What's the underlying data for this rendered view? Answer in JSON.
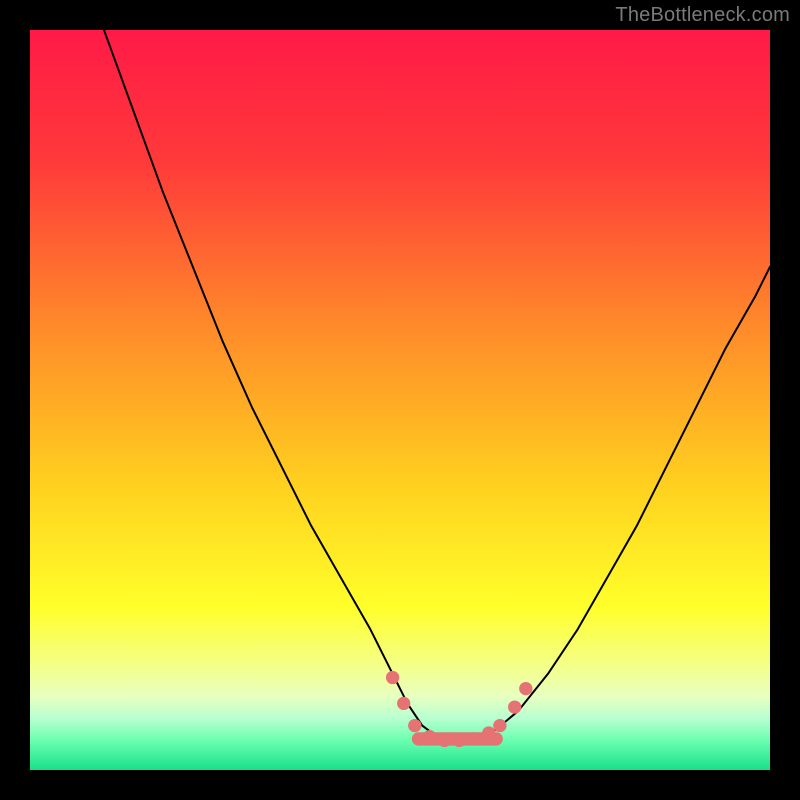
{
  "attribution": "TheBottleneck.com",
  "gradient": {
    "stops": [
      {
        "pct": 0,
        "color": "#ff1a47"
      },
      {
        "pct": 18,
        "color": "#ff3a3a"
      },
      {
        "pct": 40,
        "color": "#ff8a2a"
      },
      {
        "pct": 62,
        "color": "#ffd21f"
      },
      {
        "pct": 78,
        "color": "#ffff2a"
      },
      {
        "pct": 86,
        "color": "#f4ff8a"
      },
      {
        "pct": 90,
        "color": "#e8ffc0"
      },
      {
        "pct": 93,
        "color": "#b8ffd0"
      },
      {
        "pct": 96,
        "color": "#6affb0"
      },
      {
        "pct": 100,
        "color": "#18e08a"
      }
    ]
  },
  "chart_data": {
    "type": "line",
    "title": "",
    "xlabel": "",
    "ylabel": "",
    "xlim": [
      0,
      100
    ],
    "ylim": [
      0,
      100
    ],
    "series": [
      {
        "name": "curve",
        "color": "#000000",
        "stroke_width": 2,
        "x": [
          10,
          14,
          18,
          22,
          26,
          30,
          34,
          38,
          42,
          46,
          49,
          51,
          53,
          55,
          57,
          59,
          61,
          63,
          66,
          70,
          74,
          78,
          82,
          86,
          90,
          94,
          98,
          100
        ],
        "y": [
          100,
          89,
          78,
          68,
          58,
          49,
          41,
          33,
          26,
          19,
          13,
          9,
          6,
          4.5,
          4,
          4,
          4.5,
          5.5,
          8,
          13,
          19,
          26,
          33,
          41,
          49,
          57,
          64,
          68
        ]
      }
    ],
    "markers": {
      "name": "highlight-dots",
      "color": "#e57373",
      "radius_frac": 0.009,
      "points": [
        {
          "x": 49.0,
          "y": 12.5
        },
        {
          "x": 50.5,
          "y": 9.0
        },
        {
          "x": 52.0,
          "y": 6.0
        },
        {
          "x": 54.0,
          "y": 4.5
        },
        {
          "x": 56.0,
          "y": 4.0
        },
        {
          "x": 58.0,
          "y": 4.0
        },
        {
          "x": 60.0,
          "y": 4.2
        },
        {
          "x": 62.0,
          "y": 5.0
        },
        {
          "x": 63.5,
          "y": 6.0
        },
        {
          "x": 65.5,
          "y": 8.5
        },
        {
          "x": 67.0,
          "y": 11.0
        }
      ]
    },
    "flat_segment": {
      "name": "valley-bar",
      "color": "#e57373",
      "y": 4.2,
      "x_start": 52.5,
      "x_end": 63.0,
      "thickness_frac": 0.018
    }
  }
}
